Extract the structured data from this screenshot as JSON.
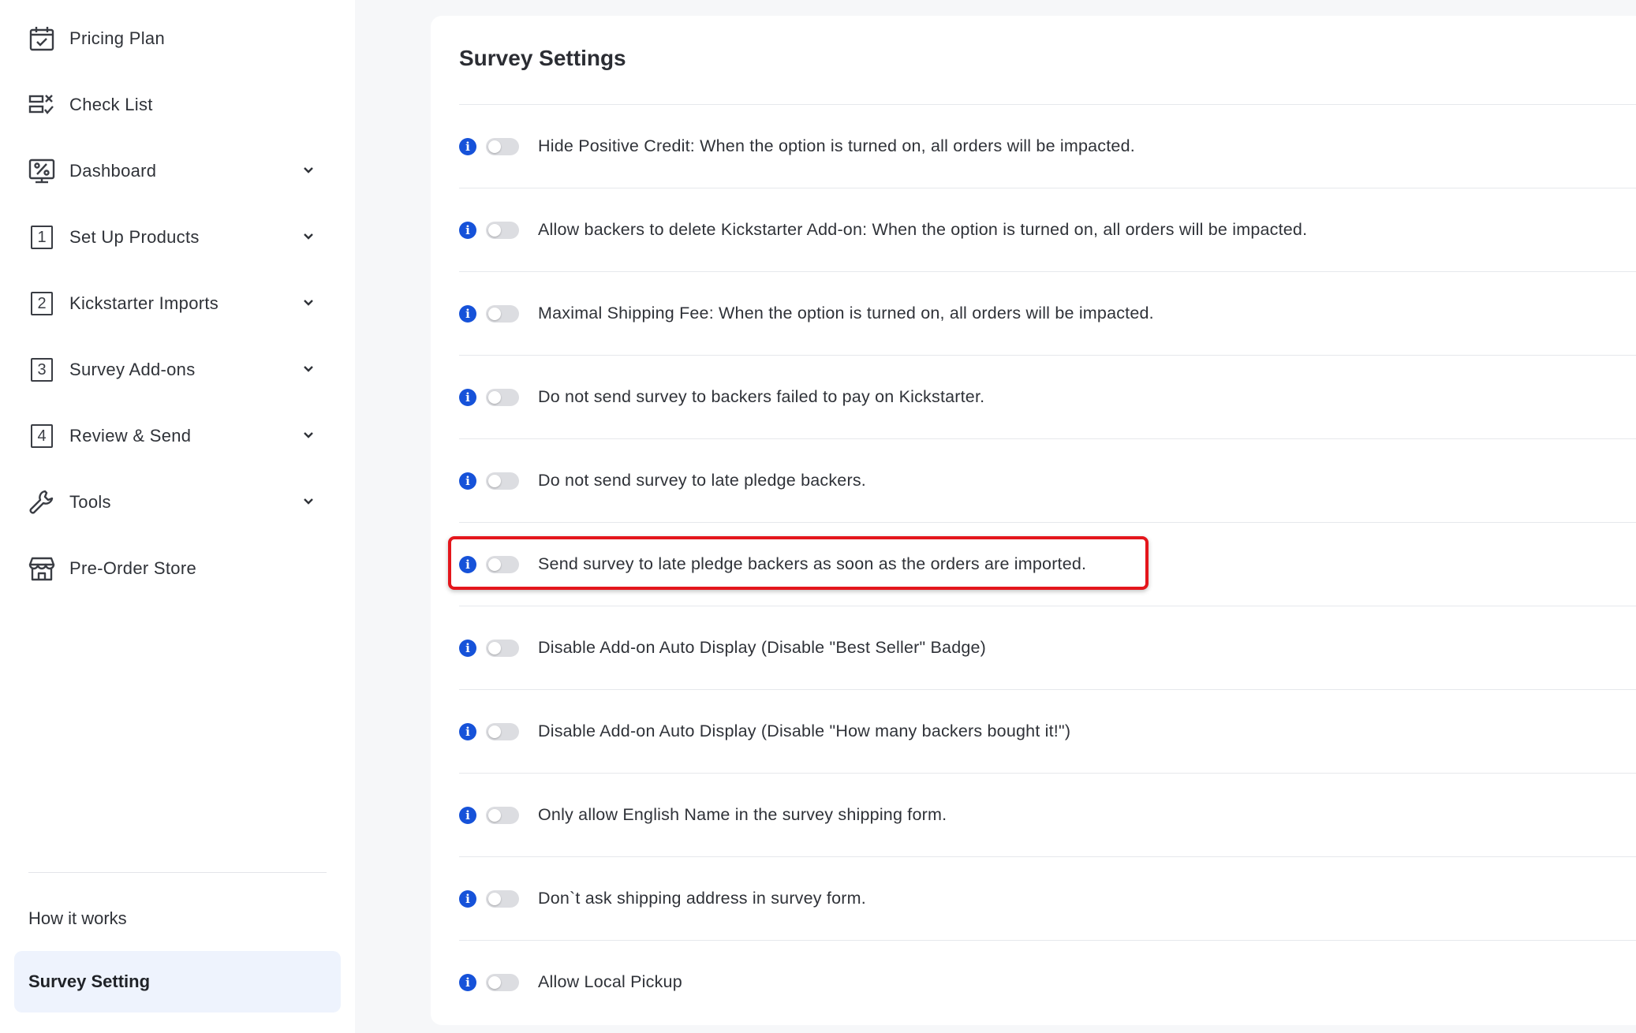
{
  "sidebar": {
    "items": [
      {
        "label": "Pricing Plan",
        "icon": "calendar-check-icon",
        "expandable": false
      },
      {
        "label": "Check List",
        "icon": "checklist-icon",
        "expandable": false
      },
      {
        "label": "Dashboard",
        "icon": "dashboard-percent-icon",
        "expandable": true
      },
      {
        "label": "Set Up Products",
        "icon": "step-1-icon",
        "step": "1",
        "expandable": true
      },
      {
        "label": "Kickstarter Imports",
        "icon": "step-2-icon",
        "step": "2",
        "expandable": true
      },
      {
        "label": "Survey Add-ons",
        "icon": "step-3-icon",
        "step": "3",
        "expandable": true
      },
      {
        "label": "Review & Send",
        "icon": "step-4-icon",
        "step": "4",
        "expandable": true
      },
      {
        "label": "Tools",
        "icon": "wrench-icon",
        "expandable": true
      },
      {
        "label": "Pre-Order Store",
        "icon": "store-icon",
        "expandable": false
      }
    ],
    "how_it_works": "How it works",
    "active": "Survey Setting"
  },
  "panel": {
    "title": "Survey Settings",
    "settings": [
      {
        "label": "Hide Positive Credit: When the option is turned on, all orders will be impacted.",
        "enabled": false
      },
      {
        "label": "Allow backers to delete Kickstarter Add-on: When the option is turned on, all orders will be impacted.",
        "enabled": false
      },
      {
        "label": "Maximal Shipping Fee: When the option is turned on, all orders will be impacted.",
        "enabled": false
      },
      {
        "label": "Do not send survey to backers failed to pay on Kickstarter.",
        "enabled": false
      },
      {
        "label": "Do not send survey to late pledge backers.",
        "enabled": false
      },
      {
        "label": "Send survey to late pledge backers as soon as the orders are imported.",
        "enabled": false,
        "highlighted": true
      },
      {
        "label": "Disable Add-on Auto Display (Disable \"Best Seller\" Badge)",
        "enabled": false
      },
      {
        "label": "Disable Add-on Auto Display (Disable \"How many backers bought it!\")",
        "enabled": false
      },
      {
        "label": "Only allow English Name in the survey shipping form.",
        "enabled": false
      },
      {
        "label": "Don`t ask shipping address in survey form.",
        "enabled": false
      },
      {
        "label": "Allow Local Pickup",
        "enabled": false
      }
    ]
  },
  "colors": {
    "info_icon": "#1652d9",
    "highlight_border": "#e4161c",
    "active_bg": "#eef3fd",
    "toggle_off": "#dcdde1"
  }
}
